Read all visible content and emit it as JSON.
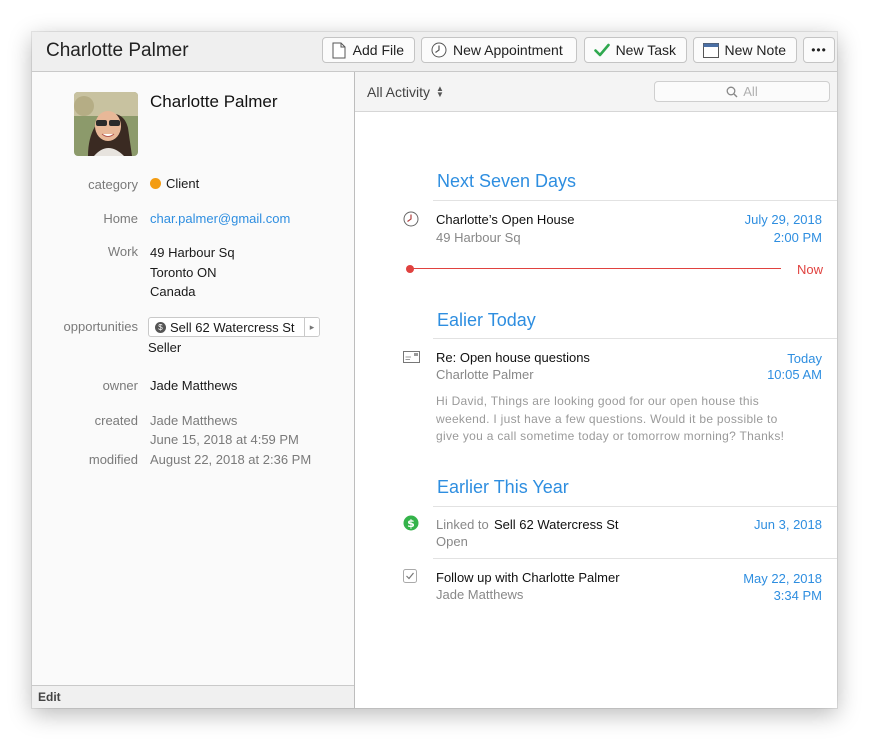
{
  "window": {
    "title": "Charlotte Palmer"
  },
  "toolbar": {
    "add_file": "Add File",
    "new_appointment": "New Appointment",
    "new_task": "New Task",
    "new_note": "New Note",
    "more": "•••"
  },
  "contact": {
    "name": "Charlotte Palmer",
    "fields": {
      "category_label": "category",
      "category_value": "Client",
      "home_label": "Home",
      "home_value": "char.palmer@gmail.com",
      "work_label": "Work",
      "work_line1": "49 Harbour Sq",
      "work_line2": "Toronto ON",
      "work_line3": "Canada",
      "opportunities_label": "opportunities",
      "opportunity_name": "Sell 62 Watercress St",
      "opportunity_role": "Seller",
      "owner_label": "owner",
      "owner_value": "Jade Matthews",
      "created_label": "created",
      "created_by": "Jade Matthews",
      "created_date": "June 15, 2018 at 4:59 PM",
      "modified_label": "modified",
      "modified_date": "August 22, 2018 at 2:36 PM"
    },
    "edit_label": "Edit"
  },
  "activity": {
    "filter_label": "All Activity",
    "search_placeholder": "All",
    "now_label": "Now",
    "sections": [
      {
        "title": "Next Seven Days",
        "items": [
          {
            "title": "Charlotte’s Open House",
            "sub": "49 Harbour Sq",
            "date": "July 29, 2018",
            "time": "2:00 PM",
            "icon": "clock-icon"
          }
        ]
      },
      {
        "title": "Ealier Today",
        "items": [
          {
            "title": "Re: Open house questions",
            "sub": "Charlotte Palmer",
            "date": "Today",
            "time": "10:05 AM",
            "icon": "email-icon",
            "body": [
              "Hi David, Things are looking good for our open house this",
              "weekend. I just have a few questions. Would it be possible to",
              "give you a call sometime today or tomorrow morning? Thanks!"
            ]
          }
        ]
      },
      {
        "title": "Earlier This Year",
        "items": [
          {
            "prefix": "Linked to",
            "title": "Sell 62 Watercress St",
            "sub": "Open",
            "date": "Jun 3, 2018",
            "icon": "dollar-icon"
          },
          {
            "title": "Follow up with Charlotte Palmer",
            "sub": "Jade Matthews",
            "date": "May 22, 2018",
            "time": "3:34 PM",
            "icon": "checkbox-icon"
          }
        ]
      }
    ]
  },
  "colors": {
    "accent": "#2e8ee0",
    "now_line": "#e0423f",
    "category_dot": "#f39c12",
    "dollar_green": "#34b34a"
  }
}
